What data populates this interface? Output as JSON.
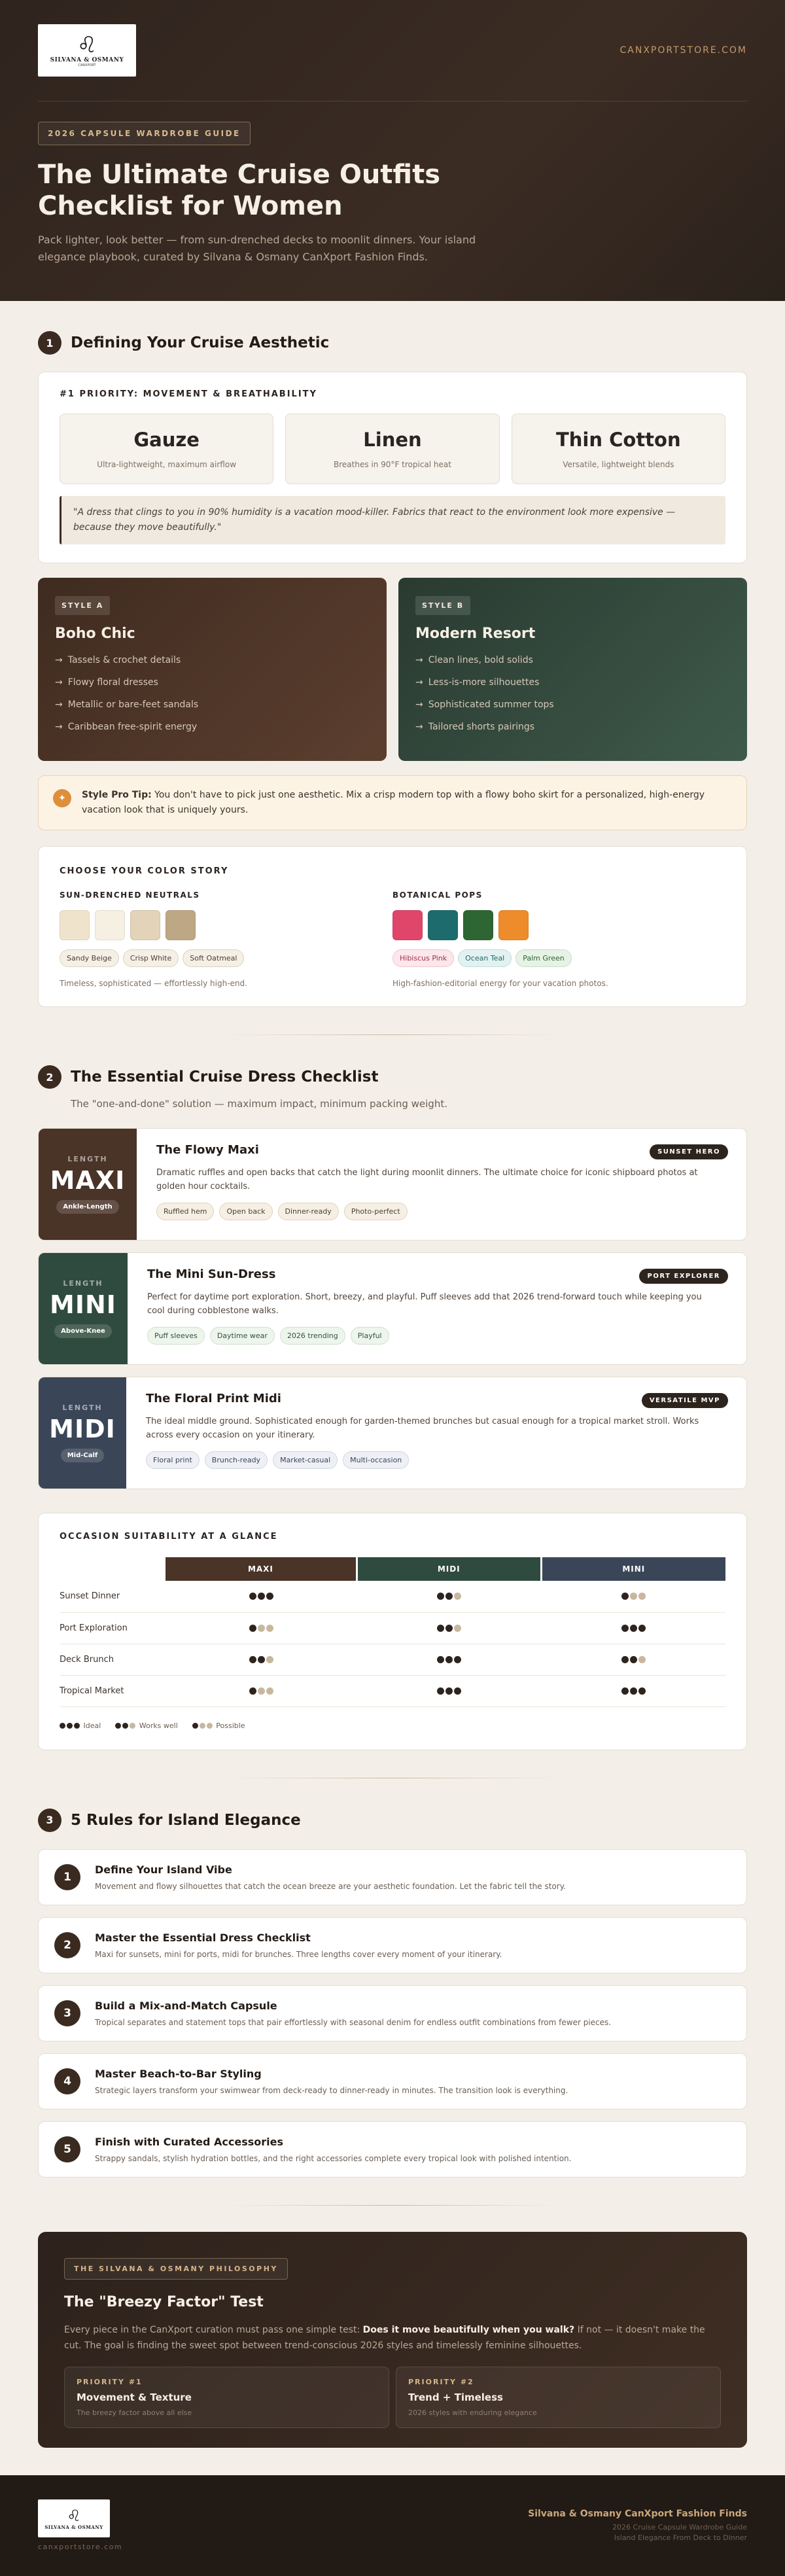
{
  "hero": {
    "logo_brand": "SILVANA & OSMANY",
    "logo_sub": "CANXPORT",
    "site": "CANXPORTSTORE.COM",
    "badge": "2026 CAPSULE WARDROBE GUIDE",
    "title": "The Ultimate Cruise Outfits Checklist for Women",
    "intro": "Pack lighter, look better — from sun-drenched decks to moonlit dinners. Your island elegance playbook, curated by Silvana & Osmany CanXport Fashion Finds."
  },
  "s1": {
    "num": "1",
    "title": "Defining Your Cruise Aesthetic",
    "priority": "#1 PRIORITY: MOVEMENT & BREATHABILITY",
    "fabrics": [
      {
        "name": "Gauze",
        "desc": "Ultra-lightweight, maximum airflow"
      },
      {
        "name": "Linen",
        "desc": "Breathes in 90°F tropical heat"
      },
      {
        "name": "Thin Cotton",
        "desc": "Versatile, lightweight blends"
      }
    ],
    "quote": "\"A dress that clings to you in 90% humidity is a vacation mood-killer. Fabrics that react to the environment look more expensive — because they move beautifully.\"",
    "style_a": {
      "tag": "STYLE A",
      "title": "Boho Chic",
      "items": [
        "Tassels & crochet details",
        "Flowy floral dresses",
        "Metallic or bare-feet sandals",
        "Caribbean free-spirit energy"
      ]
    },
    "style_b": {
      "tag": "STYLE B",
      "title": "Modern Resort",
      "items": [
        "Clean lines, bold solids",
        "Less-is-more silhouettes",
        "Sophisticated summer tops",
        "Tailored shorts pairings"
      ]
    },
    "tip_icon": "✦",
    "tip_label": "Style Pro Tip:",
    "tip_text": " You don't have to pick just one aesthetic. Mix a crisp modern top with a flowy boho skirt for a personalized, high-energy vacation look that is uniquely yours.",
    "color_title": "CHOOSE YOUR COLOR STORY",
    "neutrals": {
      "title": "SUN-DRENCHED NEUTRALS",
      "colors": [
        "#efe3cc",
        "#f6f0e3",
        "#e2d3b9",
        "#bea784"
      ],
      "chips": [
        "Sandy Beige",
        "Crisp White",
        "Soft Oatmeal"
      ],
      "note": "Timeless, sophisticated — effortlessly high-end."
    },
    "pops": {
      "title": "BOTANICAL POPS",
      "colors": [
        "#e0456a",
        "#1e6b6e",
        "#2d6632",
        "#ee8b2a"
      ],
      "chips": [
        "Hibiscus Pink",
        "Ocean Teal",
        "Palm Green"
      ],
      "note": "High-fashion-editorial energy for your vacation photos."
    }
  },
  "s2": {
    "num": "2",
    "title": "The Essential Cruise Dress Checklist",
    "sub": "The \"one-and-done\" solution — maximum impact, minimum packing weight.",
    "dresses": [
      {
        "len_label": "LENGTH",
        "len": "MAXI",
        "pill": "Ankle-Length",
        "title": "The Flowy Maxi",
        "tag": "SUNSET HERO",
        "desc": "Dramatic ruffles and open backs that catch the light during moonlit dinners. The ultimate choice for iconic shipboard photos at golden hour cocktails.",
        "chips": [
          "Ruffled hem",
          "Open back",
          "Dinner-ready",
          "Photo-perfect"
        ]
      },
      {
        "len_label": "LENGTH",
        "len": "MINI",
        "pill": "Above-Knee",
        "title": "The Mini Sun-Dress",
        "tag": "PORT EXPLORER",
        "desc": "Perfect for daytime port exploration. Short, breezy, and playful. Puff sleeves add that 2026 trend-forward touch while keeping you cool during cobblestone walks.",
        "chips": [
          "Puff sleeves",
          "Daytime wear",
          "2026 trending",
          "Playful"
        ]
      },
      {
        "len_label": "LENGTH",
        "len": "MIDI",
        "pill": "Mid-Calf",
        "title": "The Floral Print Midi",
        "tag": "VERSATILE MVP",
        "desc": "The ideal middle ground. Sophisticated enough for garden-themed brunches but casual enough for a tropical market stroll. Works across every occasion on your itinerary.",
        "chips": [
          "Floral print",
          "Brunch-ready",
          "Market-casual",
          "Multi-occasion"
        ]
      }
    ],
    "table": {
      "title": "OCCASION SUITABILITY AT A GLANCE",
      "columns": [
        "MAXI",
        "MIDI",
        "MINI"
      ],
      "rows": [
        {
          "occasion": "Sunset Dinner",
          "scores": [
            3,
            2,
            1
          ]
        },
        {
          "occasion": "Port Exploration",
          "scores": [
            1,
            2,
            3
          ]
        },
        {
          "occasion": "Deck Brunch",
          "scores": [
            2,
            3,
            2
          ]
        },
        {
          "occasion": "Tropical Market",
          "scores": [
            1,
            3,
            3
          ]
        }
      ],
      "legend": [
        "Ideal",
        "Works well",
        "Possible"
      ]
    }
  },
  "s3": {
    "num": "3",
    "title": "5 Rules for Island Elegance",
    "rules": [
      {
        "n": "1",
        "title": "Define Your Island Vibe",
        "desc": "Movement and flowy silhouettes that catch the ocean breeze are your aesthetic foundation. Let the fabric tell the story."
      },
      {
        "n": "2",
        "title": "Master the Essential Dress Checklist",
        "desc": "Maxi for sunsets, mini for ports, midi for brunches. Three lengths cover every moment of your itinerary."
      },
      {
        "n": "3",
        "title": "Build a Mix-and-Match Capsule",
        "desc": "Tropical separates and statement tops that pair effortlessly with seasonal denim for endless outfit combinations from fewer pieces."
      },
      {
        "n": "4",
        "title": "Master Beach-to-Bar Styling",
        "desc": "Strategic layers transform your swimwear from deck-ready to dinner-ready in minutes. The transition look is everything."
      },
      {
        "n": "5",
        "title": "Finish with Curated Accessories",
        "desc": "Strappy sandals, stylish hydration bottles, and the right accessories complete every tropical look with polished intention."
      }
    ]
  },
  "philo": {
    "tag": "THE SILVANA & OSMANY PHILOSOPHY",
    "title": "The \"Breezy Factor\" Test",
    "text_a": "Every piece in the CanXport curation must pass one simple test: ",
    "text_b": "Does it move beautifully when you walk?",
    "text_c": " If not — it doesn't make the cut. The goal is finding the sweet spot between trend-conscious 2026 styles and timelessly feminine silhouettes.",
    "priorities": [
      {
        "label": "PRIORITY #1",
        "title": "Movement & Texture",
        "desc": "The breezy factor above all else"
      },
      {
        "label": "PRIORITY #2",
        "title": "Trend + Timeless",
        "desc": "2026 styles with enduring elegance"
      }
    ]
  },
  "footer": {
    "site": "canxportstore.com",
    "brand": "Silvana & Osmany CanXport Fashion Finds",
    "line1": "2026 Cruise Capsule Wardrobe Guide",
    "line2": "Island Elegance From Deck to Dinner"
  }
}
